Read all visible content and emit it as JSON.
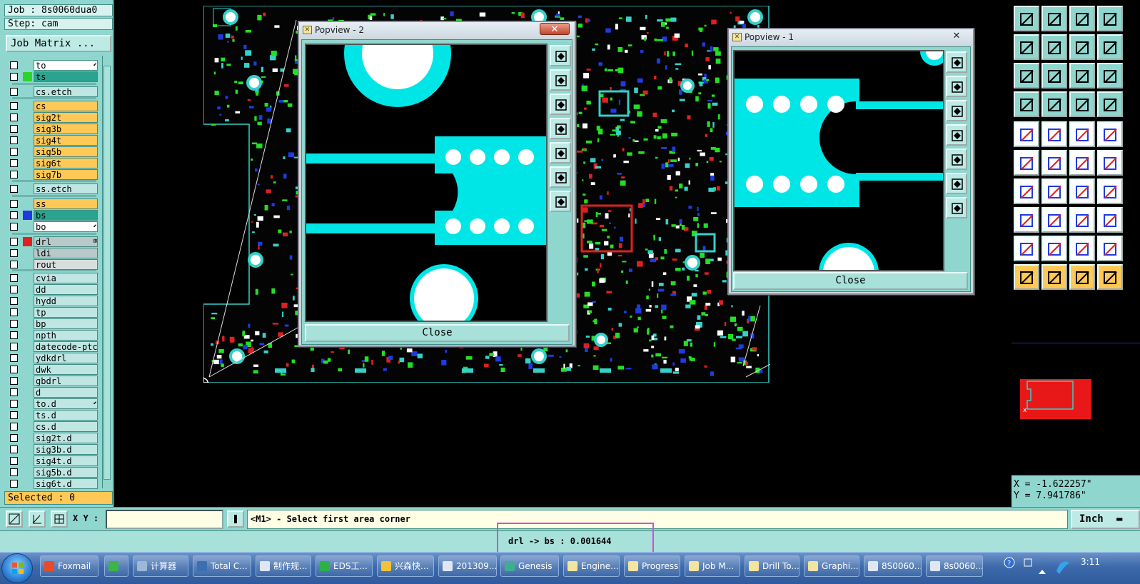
{
  "job": {
    "job_label": "Job : 8s0060dua0",
    "step_label": "Step: cam",
    "matrix_button": "Job Matrix ..."
  },
  "layers": [
    {
      "name": "to",
      "color": "#ffffff",
      "swatch": "",
      "mark": "⬋"
    },
    {
      "name": "ts",
      "color": "#2aa38f",
      "swatch": "#2bd52b",
      "mark": ""
    },
    {
      "name": "cs.etch",
      "color": "#bfe6e2",
      "swatch": "",
      "mark": ""
    },
    {
      "name": "cs",
      "color": "#ffc857",
      "swatch": "",
      "mark": ""
    },
    {
      "name": "sig2t",
      "color": "#ffc857",
      "swatch": "",
      "mark": ""
    },
    {
      "name": "sig3b",
      "color": "#ffc857",
      "swatch": "",
      "mark": ""
    },
    {
      "name": "sig4t",
      "color": "#ffc857",
      "swatch": "",
      "mark": ""
    },
    {
      "name": "sig5b",
      "color": "#ffc857",
      "swatch": "",
      "mark": ""
    },
    {
      "name": "sig6t",
      "color": "#ffc857",
      "swatch": "",
      "mark": ""
    },
    {
      "name": "sig7b",
      "color": "#ffc857",
      "swatch": "",
      "mark": ""
    },
    {
      "name": "ss.etch",
      "color": "#bfe6e2",
      "swatch": "",
      "mark": ""
    },
    {
      "name": "ss",
      "color": "#ffc857",
      "swatch": "",
      "mark": ""
    },
    {
      "name": "bs",
      "color": "#2aa38f",
      "swatch": "#1f3be0",
      "mark": ""
    },
    {
      "name": "bo",
      "color": "#ffffff",
      "swatch": "",
      "mark": "⬋"
    },
    {
      "name": "drl",
      "color": "#b9c8c8",
      "swatch": "#e02020",
      "mark": "⊞"
    },
    {
      "name": "ldi",
      "color": "#b9c8c8",
      "swatch": "",
      "mark": ""
    },
    {
      "name": "rout",
      "color": "#d8dede",
      "swatch": "",
      "mark": ""
    },
    {
      "name": "cvia",
      "color": "#bfe6e2",
      "swatch": "",
      "mark": ""
    },
    {
      "name": "dd",
      "color": "#bfe6e2",
      "swatch": "",
      "mark": ""
    },
    {
      "name": "hydd",
      "color": "#bfe6e2",
      "swatch": "",
      "mark": ""
    },
    {
      "name": "tp",
      "color": "#bfe6e2",
      "swatch": "",
      "mark": ""
    },
    {
      "name": "bp",
      "color": "#bfe6e2",
      "swatch": "",
      "mark": ""
    },
    {
      "name": "npth",
      "color": "#bfe6e2",
      "swatch": "",
      "mark": ""
    },
    {
      "name": "datecode-ptc",
      "color": "#bfe6e2",
      "swatch": "",
      "mark": ""
    },
    {
      "name": "ydkdrl",
      "color": "#bfe6e2",
      "swatch": "",
      "mark": ""
    },
    {
      "name": "dwk",
      "color": "#bfe6e2",
      "swatch": "",
      "mark": ""
    },
    {
      "name": "gbdrl",
      "color": "#bfe6e2",
      "swatch": "",
      "mark": ""
    },
    {
      "name": "d",
      "color": "#bfe6e2",
      "swatch": "",
      "mark": ""
    },
    {
      "name": "to.d",
      "color": "#bfe6e2",
      "swatch": "",
      "mark": "⬋"
    },
    {
      "name": "ts.d",
      "color": "#bfe6e2",
      "swatch": "",
      "mark": ""
    },
    {
      "name": "cs.d",
      "color": "#bfe6e2",
      "swatch": "",
      "mark": ""
    },
    {
      "name": "sig2t.d",
      "color": "#bfe6e2",
      "swatch": "",
      "mark": ""
    },
    {
      "name": "sig3b.d",
      "color": "#bfe6e2",
      "swatch": "",
      "mark": ""
    },
    {
      "name": "sig4t.d",
      "color": "#bfe6e2",
      "swatch": "",
      "mark": ""
    },
    {
      "name": "sig5b.d",
      "color": "#bfe6e2",
      "swatch": "",
      "mark": ""
    },
    {
      "name": "sig6t.d",
      "color": "#bfe6e2",
      "swatch": "",
      "mark": ""
    }
  ],
  "selected_label": "Selected : 0",
  "popview2": {
    "title": "Popview - 2",
    "close_label": "Close"
  },
  "popview1": {
    "title": "Popview - 1",
    "close_label": "Close"
  },
  "coords": {
    "x": "X = -1.622257\"",
    "y": "Y = 7.941786\""
  },
  "command_bar": {
    "xy_label": "X Y :",
    "xy_value": "",
    "message": "<M1> - Select first area corner",
    "unit": "Inch"
  },
  "status_bar": {
    "text": "drl -> bs : 0.001644"
  },
  "taskbar": {
    "items": [
      {
        "label": "Foxmail",
        "icon": "#e84a2a"
      },
      {
        "label": "",
        "icon": "#3bb54a"
      },
      {
        "label": "计算器",
        "icon": "#9db7d6"
      },
      {
        "label": "Total C...",
        "icon": "#3a6fb0"
      },
      {
        "label": "制作规...",
        "icon": "#dfe8f2"
      },
      {
        "label": "EDS工...",
        "icon": "#2db04a"
      },
      {
        "label": "兴森快...",
        "icon": "#f2c23a"
      },
      {
        "label": "201309...",
        "icon": "#dfe8f2"
      },
      {
        "label": "Genesis",
        "icon": "#3fae8f"
      },
      {
        "label": "Engine...",
        "icon": "#f3e5a0"
      },
      {
        "label": "Progress",
        "icon": "#f3e5a0"
      },
      {
        "label": "Job M...",
        "icon": "#f3e5a0"
      },
      {
        "label": "Drill To...",
        "icon": "#f3e5a0"
      },
      {
        "label": "Graphi...",
        "icon": "#f3e5a0"
      },
      {
        "label": "8S0060...",
        "icon": "#dfe8f2"
      },
      {
        "label": "8s0060...",
        "icon": "#dfe8f2"
      }
    ],
    "clock": "3:11"
  }
}
